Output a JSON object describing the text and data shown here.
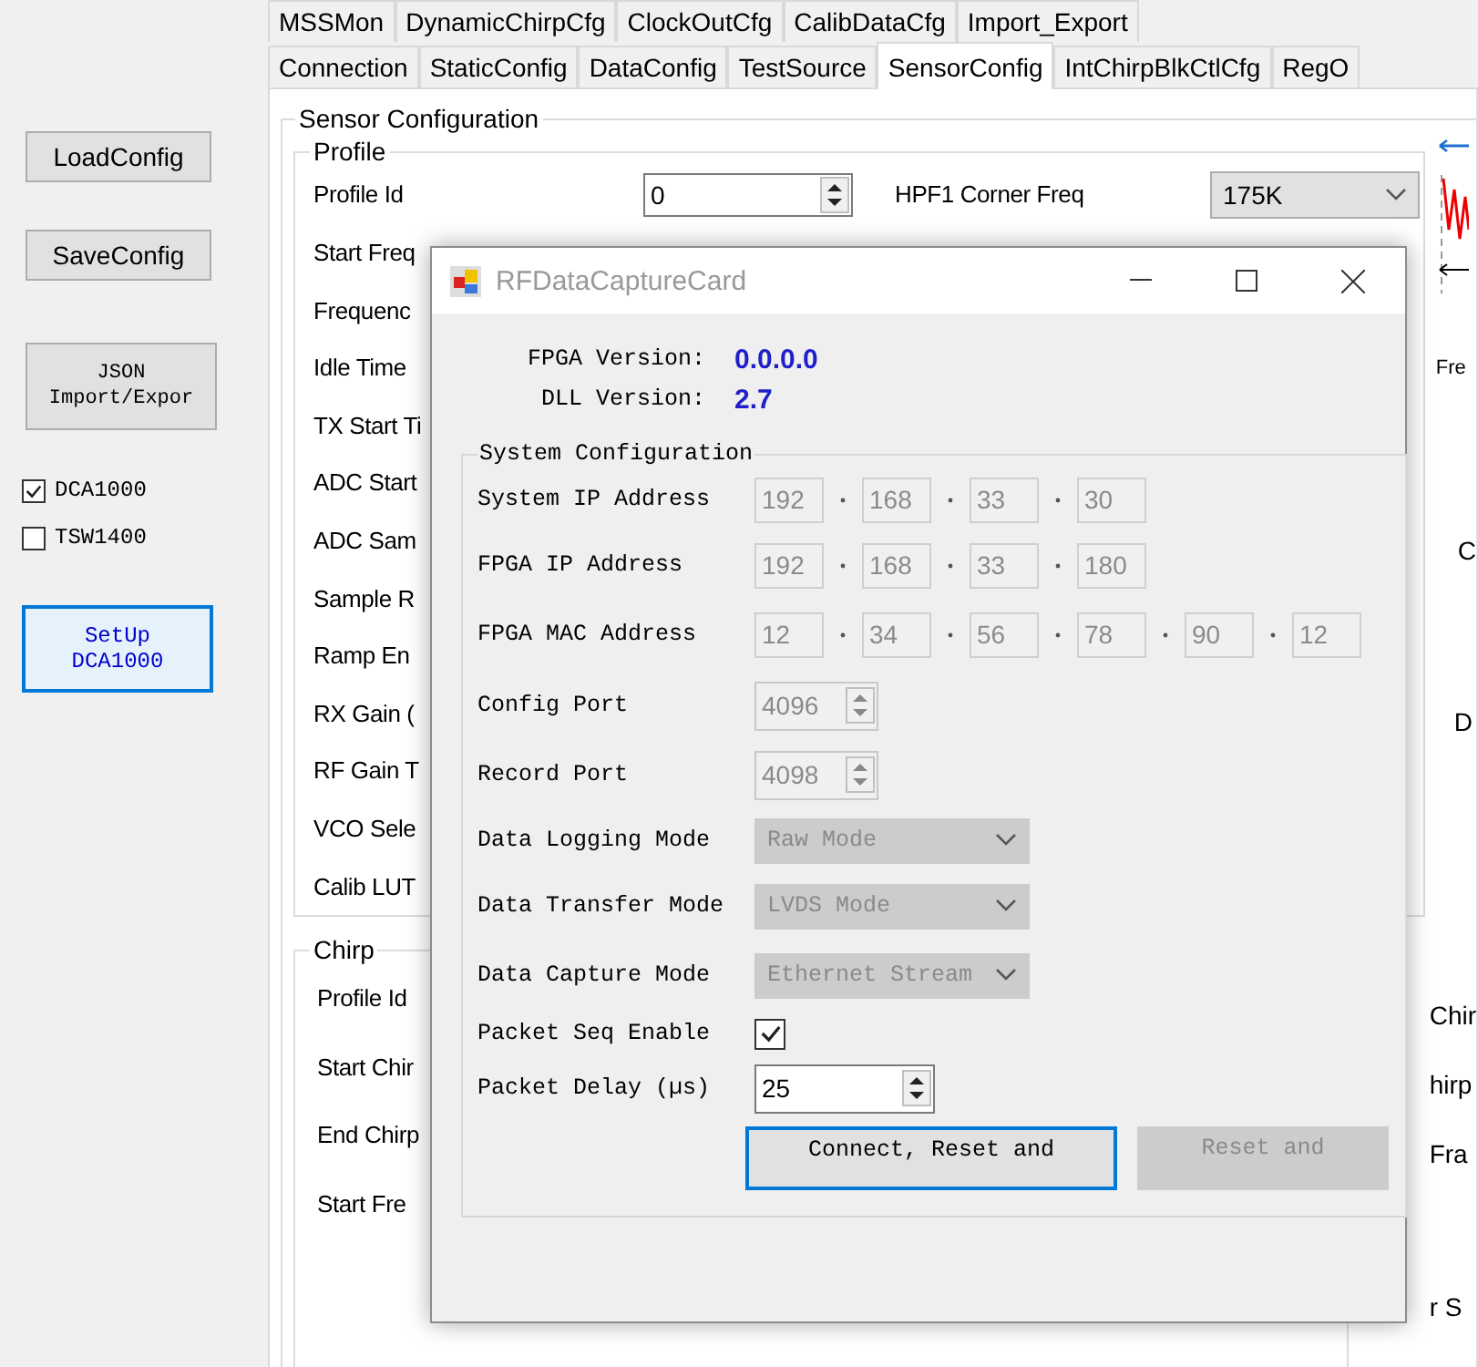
{
  "tabs_row_1": [
    {
      "label": "MSSMon",
      "selected": false
    },
    {
      "label": "DynamicChirpCfg",
      "selected": false
    },
    {
      "label": "ClockOutCfg",
      "selected": false
    },
    {
      "label": "CalibDataCfg",
      "selected": false
    },
    {
      "label": "Import_Export",
      "selected": false
    }
  ],
  "tabs_row_2": [
    {
      "label": "Connection",
      "selected": false
    },
    {
      "label": "StaticConfig",
      "selected": false
    },
    {
      "label": "DataConfig",
      "selected": false
    },
    {
      "label": "TestSource",
      "selected": false
    },
    {
      "label": "SensorConfig",
      "selected": true
    },
    {
      "label": "IntChirpBlkCtlCfg",
      "selected": false
    },
    {
      "label": "RegO",
      "selected": false
    }
  ],
  "sidebar": {
    "buttons": [
      {
        "kind": "plain",
        "lines": [
          "LoadConfig"
        ]
      },
      {
        "kind": "plain",
        "lines": [
          "SaveConfig"
        ]
      },
      {
        "kind": "mono",
        "lines": [
          "JSON",
          "Import/Expor"
        ]
      }
    ],
    "checkboxes": [
      {
        "label": "DCA1000",
        "checked": true
      },
      {
        "label": "TSW1400",
        "checked": false
      }
    ],
    "setup_button": {
      "lines": [
        "SetUp",
        "DCA1000"
      ],
      "focused": true
    }
  },
  "sensor_configuration": {
    "title": "Sensor Configuration",
    "profile": {
      "title": "Profile",
      "first_row": {
        "label": "Profile Id",
        "value": "0",
        "hpf_label": "HPF1 Corner Freq",
        "hpf_value": "175K"
      },
      "labels": [
        "Start Freq",
        "Frequenc",
        "Idle Time",
        "TX Start Ti",
        "ADC Start",
        "ADC Sam",
        "Sample R",
        "Ramp En",
        "RX Gain (",
        "RF Gain T",
        "VCO Sele",
        "Calib LUT"
      ]
    },
    "chart_caption": "Fre",
    "group_c": "C",
    "group_d": "D",
    "chirp": {
      "title": "Chirp",
      "labels": [
        "Profile Id",
        "Start Chir",
        "End Chirp",
        "Start Fre"
      ]
    },
    "right_labels": [
      "Chir",
      "hirp",
      "Fra",
      "r S"
    ]
  },
  "dialog": {
    "title": "RFDataCaptureCard",
    "versions": [
      {
        "label": "FPGA Version:",
        "value": "0.0.0.0"
      },
      {
        "label": "DLL Version:",
        "value": "2.7"
      }
    ],
    "group_title": "System Configuration",
    "rows": [
      {
        "kind": "address",
        "label": "System IP Address",
        "parts": [
          "192",
          "168",
          "33",
          "30"
        ]
      },
      {
        "kind": "address",
        "label": "FPGA IP Address",
        "parts": [
          "192",
          "168",
          "33",
          "180"
        ]
      },
      {
        "kind": "address",
        "label": "FPGA MAC Address",
        "parts": [
          "12",
          "34",
          "56",
          "78",
          "90",
          "12"
        ]
      },
      {
        "kind": "spinner",
        "label": "Config Port",
        "value": "4096",
        "disabled": true
      },
      {
        "kind": "spinner",
        "label": "Record Port",
        "value": "4098",
        "disabled": true
      },
      {
        "kind": "dropdown",
        "label": "Data Logging Mode",
        "value": "Raw Mode",
        "disabled": true
      },
      {
        "kind": "dropdown",
        "label": "Data Transfer Mode",
        "value": "LVDS Mode",
        "disabled": true
      },
      {
        "kind": "dropdown",
        "label": "Data Capture Mode",
        "value": "Ethernet Stream",
        "disabled": true
      },
      {
        "kind": "checkbox",
        "label": "Packet Seq Enable",
        "checked": true
      },
      {
        "kind": "spinner",
        "label": "Packet Delay (µs)",
        "value": "25",
        "disabled": false
      }
    ],
    "buttons": [
      {
        "label": "Connect, Reset and",
        "focused": true,
        "disabled": false
      },
      {
        "label": "Reset and",
        "focused": false,
        "disabled": true
      }
    ]
  }
}
